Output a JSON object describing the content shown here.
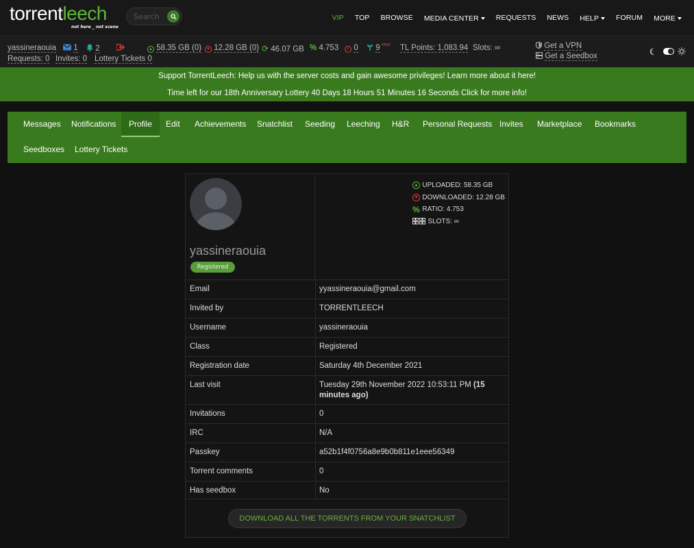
{
  "header": {
    "logo_part1": "torrent",
    "logo_part2": "leech",
    "logo_tagline": "not here _ not scene",
    "search_placeholder": "Search",
    "nav": [
      {
        "label": "VIP"
      },
      {
        "label": "TOP"
      },
      {
        "label": "BROWSE"
      },
      {
        "label": "MEDIA CENTER"
      },
      {
        "label": "REQUESTS"
      },
      {
        "label": "NEWS"
      },
      {
        "label": "HELP"
      },
      {
        "label": "FORUM"
      },
      {
        "label": "MORE"
      }
    ]
  },
  "statsbar": {
    "username": "yassineraouia",
    "messages": "1",
    "notifications": "2",
    "uploaded": "58.35 GB (0)",
    "downloaded": "12.28 GB (0)",
    "buffer": "46.07 GB",
    "ratio": "4.753",
    "hnr": "0",
    "seeding": "9",
    "new_badge": "new",
    "tl_points": "TL Points: 1,083.94",
    "slots": "Slots: ∞",
    "requests": "Requests: 0",
    "invites": "Invites: 0",
    "lottery": "Lottery Tickets 0",
    "vpn": "Get a VPN",
    "seedbox": "Get a Seedbox"
  },
  "announce": {
    "line1": "Support TorrentLeech: Help us with the server costs and gain awesome privileges! Learn more about it here!",
    "line2": "Time left for our 18th Anniversary Lottery 40 Days 18 Hours 51 Minutes 16 Seconds Click for more info!"
  },
  "tabs": {
    "messages": "Messages",
    "notifications": "Notifications",
    "profile": "Profile",
    "edit": "Edit",
    "achievements": "Achievements",
    "snatchlist": "Snatchlist",
    "seeding": "Seeding",
    "leeching": "Leeching",
    "hr": "H&R",
    "personal_requests": "Personal Requests",
    "invites": "Invites",
    "marketplace": "Marketplace",
    "bookmarks": "Bookmarks",
    "seedboxes": "Seedboxes",
    "lottery_tickets": "Lottery Tickets"
  },
  "profile": {
    "username": "yassineraouia",
    "badge": "Registered",
    "uploaded": "UPLOADED: 58.35 GB",
    "downloaded": "DOWNLOADED:  12.28 GB",
    "ratio": "RATIO: 4.753",
    "slots": "SLOTS: ∞",
    "rows": [
      {
        "key": "Email",
        "value": "yyassineraouia@gmail.com"
      },
      {
        "key": "Invited by",
        "value": "TORRENTLEECH"
      },
      {
        "key": "Username",
        "value": "yassineraouia"
      },
      {
        "key": "Class",
        "value": "Registered"
      },
      {
        "key": "Registration date",
        "value": "Saturday 4th December 2021"
      },
      {
        "key": "Last visit",
        "value": "Tuesday 29th November 2022 10:53:11 PM",
        "value_bold": "(15 minutes ago)"
      },
      {
        "key": "Invitations",
        "value": "0"
      },
      {
        "key": "IRC",
        "value": "N/A"
      },
      {
        "key": "Passkey",
        "value": "a52b1f4f0756a8e9b0b811e1eee56349"
      },
      {
        "key": "Torrent comments",
        "value": "0"
      },
      {
        "key": "Has seedbox",
        "value": "No"
      }
    ],
    "download_button": "DOWNLOAD ALL THE TORRENTS FROM YOUR SNATCHLIST"
  },
  "colors": {
    "brand_green": "#3a7a1f",
    "accent_green": "#5db93a",
    "background": "#111111"
  }
}
